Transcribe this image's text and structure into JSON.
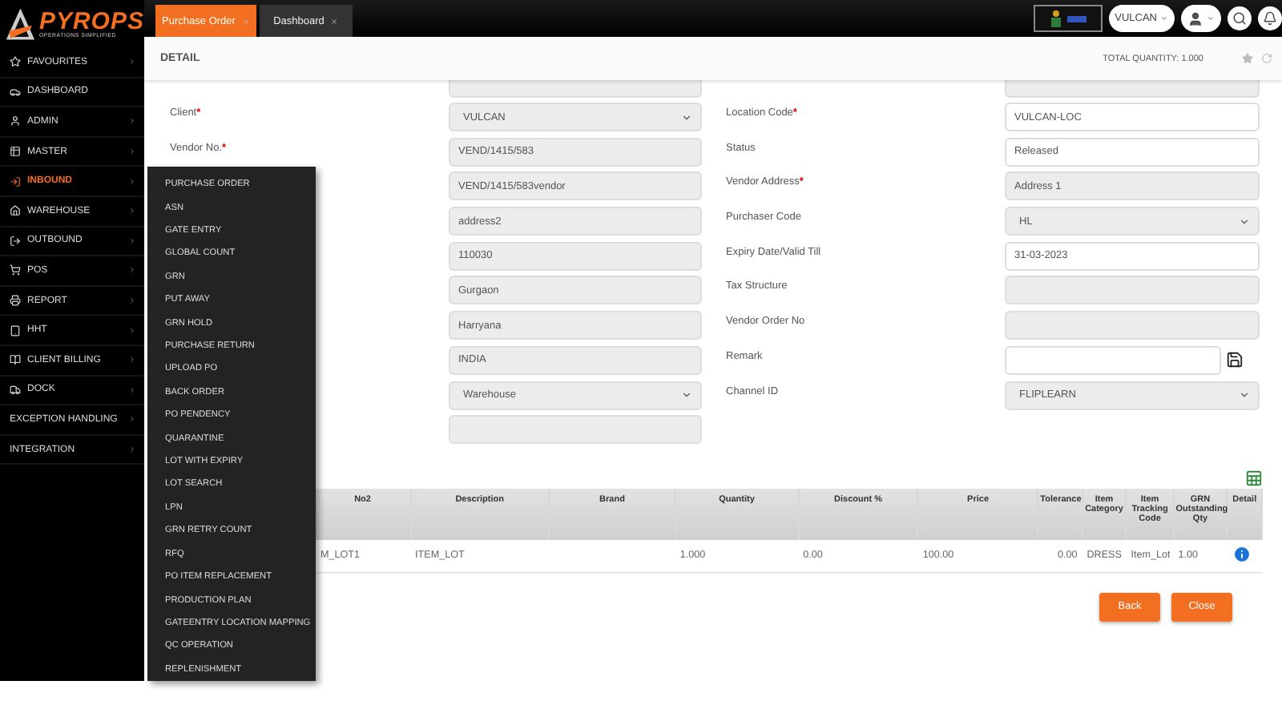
{
  "logo": {
    "name": "PYROPS",
    "tagline": "OPERATIONS SIMPLIFIED"
  },
  "tabs": [
    {
      "label": "Purchase Order",
      "selected": true
    },
    {
      "label": "Dashboard",
      "selected": false
    }
  ],
  "account": {
    "name": "VULCAN"
  },
  "sidebar": {
    "items": [
      {
        "label": "FAVOURITES",
        "selected": false,
        "submenu": true
      },
      {
        "label": "DASHBOARD",
        "selected": false,
        "submenu": false
      },
      {
        "label": "ADMIN",
        "selected": false,
        "submenu": true
      },
      {
        "label": "MASTER",
        "selected": false,
        "submenu": true
      },
      {
        "label": "INBOUND",
        "selected": true,
        "submenu": true
      },
      {
        "label": "WAREHOUSE",
        "selected": false,
        "submenu": true
      },
      {
        "label": "OUTBOUND",
        "selected": false,
        "submenu": true
      },
      {
        "label": "POS",
        "selected": false,
        "submenu": true
      },
      {
        "label": "REPORT",
        "selected": false,
        "submenu": true
      },
      {
        "label": "HHT",
        "selected": false,
        "submenu": true
      },
      {
        "label": "CLIENT BILLING",
        "selected": false,
        "submenu": true
      },
      {
        "label": "DOCK",
        "selected": false,
        "submenu": true
      },
      {
        "label": "EXCEPTION HANDLING",
        "selected": false,
        "submenu": true
      },
      {
        "label": "INTEGRATION",
        "selected": false,
        "submenu": true
      }
    ]
  },
  "flyout_menu": {
    "items": [
      "PURCHASE ORDER",
      "ASN",
      "GATE ENTRY",
      "GLOBAL COUNT",
      "GRN",
      "PUT AWAY",
      "GRN HOLD",
      "PURCHASE RETURN",
      "UPLOAD PO",
      "BACK ORDER",
      "PO PENDENCY",
      "QUARANTINE",
      "LOT WITH EXPIRY",
      "LOT SEARCH",
      "LPN",
      "GRN RETRY COUNT",
      "RFQ",
      "PO ITEM REPLACEMENT",
      "PRODUCTION PLAN",
      "GATEENTRY LOCATION MAPPING",
      "QC OPERATION",
      "REPLENISHMENT"
    ]
  },
  "detail": {
    "title": "DETAIL",
    "total": "TOTAL QUANTITY: 1.000"
  },
  "form": {
    "rows": [
      {
        "left": {
          "label": "Client",
          "required_mark": "*",
          "kind": "select",
          "value": "VULCAN",
          "disabled": true
        },
        "right": {
          "label": "Location Code",
          "required_mark": "*",
          "kind": "input",
          "value": "VULCAN-LOC",
          "disabled": false
        }
      },
      {
        "left": {
          "label": "Vendor No.",
          "required_mark": "*",
          "kind": "input",
          "value": "VEND/1415/583",
          "disabled": true
        },
        "right": {
          "label": "Status",
          "kind": "input",
          "value": "Released",
          "disabled": false
        }
      },
      {
        "left": {
          "kind": "input",
          "value": "VEND/1415/583vendor",
          "disabled": true
        },
        "right": {
          "label": "Vendor Address",
          "required_mark": "*",
          "kind": "input",
          "value": "Address 1",
          "disabled": true
        }
      },
      {
        "left": {
          "kind": "input",
          "value": "address2",
          "disabled": true
        },
        "right": {
          "label": "Purchaser Code",
          "kind": "select",
          "value": "HL",
          "disabled": true
        }
      },
      {
        "left": {
          "kind": "input",
          "value": "110030",
          "disabled": true
        },
        "right": {
          "label": "Expiry Date/Valid Till",
          "kind": "input",
          "value": "31-03-2023",
          "disabled": false
        }
      },
      {
        "left": {
          "kind": "input",
          "value": "Gurgaon",
          "disabled": true
        },
        "right": {
          "label": "Tax Structure",
          "kind": "input",
          "disabled": true
        }
      },
      {
        "left": {
          "kind": "input",
          "value": "Harryana",
          "disabled": true
        },
        "right": {
          "label": "Vendor Order No",
          "kind": "input",
          "disabled": true
        }
      },
      {
        "left": {
          "kind": "input",
          "value": "INDIA",
          "disabled": true
        },
        "right": {
          "label": "Remark",
          "kind": "attachment",
          "disabled": false
        }
      },
      {
        "left": {
          "kind": "select",
          "value": "Warehouse",
          "disabled": true
        },
        "right": {
          "label": "Channel ID",
          "kind": "select",
          "value": "FLIPLEARN",
          "disabled": true
        }
      },
      {
        "left": {
          "kind": "input",
          "disabled": true
        }
      }
    ]
  },
  "table": {
    "columns": [
      "No2",
      "Description",
      "Brand",
      "Quantity",
      "Discount %",
      "Price",
      "Tolerance",
      "Item Category",
      "Item Tracking Code",
      "GRN Outstanding Qty",
      "Detail"
    ],
    "rows": [
      {
        "cells": [
          "M_LOT1",
          "ITEM_LOT",
          null,
          "1.000",
          "0.00",
          "100.00",
          "0.00",
          "DRESS",
          "Item_Lot",
          "1.00"
        ]
      }
    ]
  },
  "buttons": [
    "Back",
    "Close"
  ]
}
